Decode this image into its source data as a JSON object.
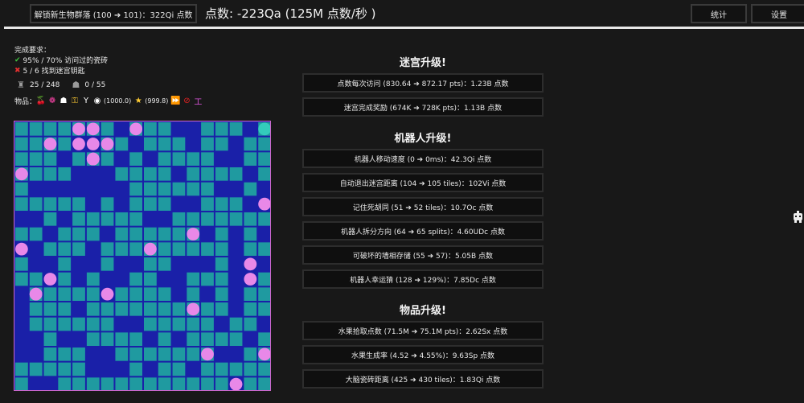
{
  "header": {
    "unlock_button": "解锁新生物群落 (100 ➔ 101)：322Qi 点数",
    "points": "点数: -223Qa (125M  点数/秒 )",
    "stats_button": "统计",
    "settings_button": "设置"
  },
  "status": {
    "requirements_title": "完成要求：",
    "req1": "95% / 70%  访问过的瓷砖",
    "req2": "5 / 6 找到迷宫钥匙",
    "robots": "25 / 248",
    "ghosts": "0 / 55",
    "items_label": "物品：",
    "item_value_a": "(1000.0)",
    "item_value_b": "(999.8)"
  },
  "sections": {
    "maze_title": "迷宫升级!",
    "robot_title": "机器人升级!",
    "item_title": "物品升级!"
  },
  "maze_upgrades": [
    "点数每次访问 (830.64 ➔ 872.17 pts)：1.23B 点数",
    "迷宫完成奖励 (674K ➔ 728K pts)：1.13B 点数"
  ],
  "robot_upgrades": [
    "机器人移动速度 (0 ➔ 0ms)：42.3Qi 点数",
    "自动退出迷宫距离 (104 ➔ 105 tiles)：102Vi 点数",
    "记住死胡同 (51 ➔ 52 tiles)：10.7Oc 点数",
    "机器人拆分方向 (64 ➔ 65 splits)：4.60UDc 点数",
    "可破坏的墙相存储 (55 ➔ 57)：5.05B 点数",
    "机器人幸运猜 (128 ➔ 129%)：7.85Dc 点数"
  ],
  "item_upgrades": [
    "水果拾取点数 (71.5M ➔ 75.1M pts)：2.62Sx 点数",
    "水果生成率 (4.52 ➔ 4.55%)：9.63Sp 点数",
    "大脑瓷砖距离 (425 ➔ 430 tiles)：1.83Qi 点数"
  ],
  "colors": {
    "background": "#181818",
    "maze_wall": "#1a20a8",
    "maze_path": "#1f9aa0",
    "robot": "#e888e8",
    "exit": "#33ccbb"
  },
  "maze": {
    "grid_size": 18,
    "robot_count": 25
  }
}
